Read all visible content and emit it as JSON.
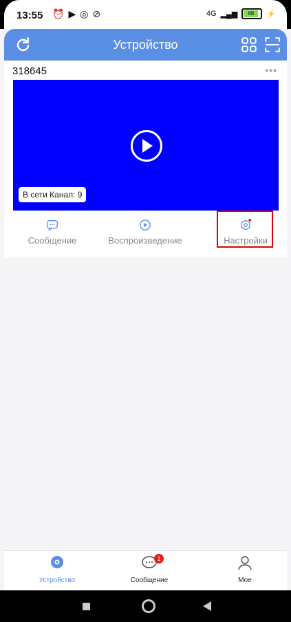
{
  "status_bar": {
    "time": "13:55",
    "network": "4G",
    "battery": "68"
  },
  "header": {
    "title": "Устройство"
  },
  "device": {
    "id": "318645",
    "status": "В сети",
    "channel_label": "Канал: 9",
    "actions": [
      {
        "label": "Сообщение"
      },
      {
        "label": "Воспроизведение"
      },
      {
        "label": "Настройки"
      }
    ]
  },
  "tabbar": {
    "tabs": [
      {
        "label": "Устройство"
      },
      {
        "label": "Сообщение",
        "badge": "1"
      },
      {
        "label": "Мое"
      }
    ]
  },
  "colors": {
    "accent": "#5b8ee5",
    "video_bg": "#0000fe",
    "alert": "#e02020"
  }
}
